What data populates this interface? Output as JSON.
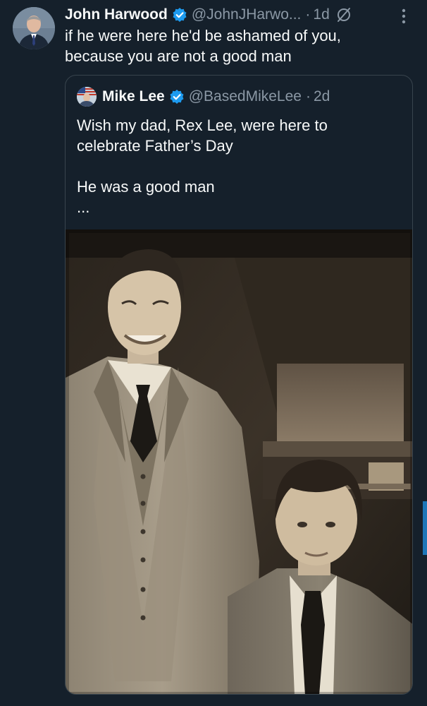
{
  "tweet": {
    "author_name": "John Harwood",
    "handle": "@JohnJHarwo...",
    "separator": "·",
    "time": "1d",
    "text_line1": "if he were here he'd be ashamed of you,",
    "text_line2": "because you are not a good man",
    "avatar_icon": "person-avatar",
    "verified_icon": "verified-badge-icon",
    "grok_icon": "grok-icon",
    "more_icon": "more-options-icon"
  },
  "quote": {
    "author_name": "Mike Lee",
    "handle": "@BasedMikeLee",
    "separator": "·",
    "time": "2d",
    "text_line1": "Wish my dad, Rex Lee, were here to",
    "text_line2": "celebrate Father’s Day",
    "text_line3": "He was a good man",
    "ellipsis": "...",
    "photo_description_icon": "sepia-photo"
  },
  "colors": {
    "background": "#15202b",
    "text": "#f7f9f9",
    "secondary_text": "#8b98a5",
    "border": "#38444d",
    "verified": "#1d9bf0",
    "scrollbar": "#1d76b8"
  }
}
